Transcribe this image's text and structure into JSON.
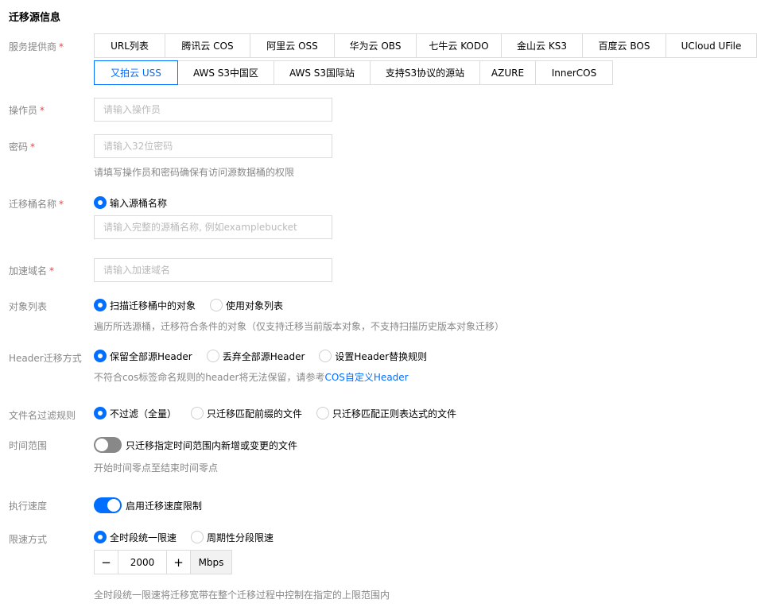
{
  "section_title": "迁移源信息",
  "colors": {
    "accent": "#006eff",
    "required": "#e54545",
    "label": "#888888",
    "border": "#dcdcdc"
  },
  "provider": {
    "label": "服务提供商",
    "required_mark": "*",
    "row1": [
      "URL列表",
      "腾讯云 COS",
      "阿里云 OSS",
      "华为云 OBS",
      "七牛云 KODO",
      "金山云 KS3",
      "百度云 BOS",
      "UCloud UFile"
    ],
    "row2": [
      "又拍云 USS",
      "AWS S3中国区",
      "AWS S3国际站",
      "支持S3协议的源站",
      "AZURE",
      "InnerCOS"
    ],
    "selected": "又拍云 USS"
  },
  "operator": {
    "label": "操作员",
    "required_mark": "*",
    "placeholder": "请输入操作员"
  },
  "password": {
    "label": "密码",
    "required_mark": "*",
    "placeholder": "请输入32位密码",
    "hint": "请填写操作员和密码确保有访问源数据桶的权限"
  },
  "bucket": {
    "label": "迁移桶名称",
    "required_mark": "*",
    "option": "输入源桶名称",
    "placeholder": "请输入完整的源桶名称, 例如examplebucket"
  },
  "domain": {
    "label": "加速域名",
    "required_mark": "*",
    "placeholder": "请输入加速域名"
  },
  "object_list": {
    "label": "对象列表",
    "options": [
      "扫描迁移桶中的对象",
      "使用对象列表"
    ],
    "selected": "扫描迁移桶中的对象",
    "hint": "遍历所选源桶，迁移符合条件的对象（仅支持迁移当前版本对象，不支持扫描历史版本对象迁移）"
  },
  "header_mode": {
    "label": "Header迁移方式",
    "options": [
      "保留全部源Header",
      "丢弃全部源Header",
      "设置Header替换规则"
    ],
    "selected": "保留全部源Header",
    "hint_prefix": "不符合cos标签命名规则的header将无法保留，请参考",
    "hint_link": "COS自定义Header"
  },
  "filename_filter": {
    "label": "文件名过滤规则",
    "options": [
      "不过滤（全量）",
      "只迁移匹配前缀的文件",
      "只迁移匹配正则表达式的文件"
    ],
    "selected": "不过滤（全量）"
  },
  "time_range": {
    "label": "时间范围",
    "switch_label": "只迁移指定时间范围内新增或变更的文件",
    "enabled": false,
    "hint": "开始时间零点至结束时间零点"
  },
  "speed": {
    "label": "执行速度",
    "switch_label": "启用迁移速度限制",
    "enabled": true
  },
  "limit_mode": {
    "label": "限速方式",
    "options": [
      "全时段统一限速",
      "周期性分段限速"
    ],
    "selected": "全时段统一限速",
    "minus": "−",
    "plus": "+",
    "value": "2000",
    "unit": "Mbps",
    "hint": "全时段统一限速将迁移宽带在整个迁移过程中控制在指定的上限范围内"
  }
}
